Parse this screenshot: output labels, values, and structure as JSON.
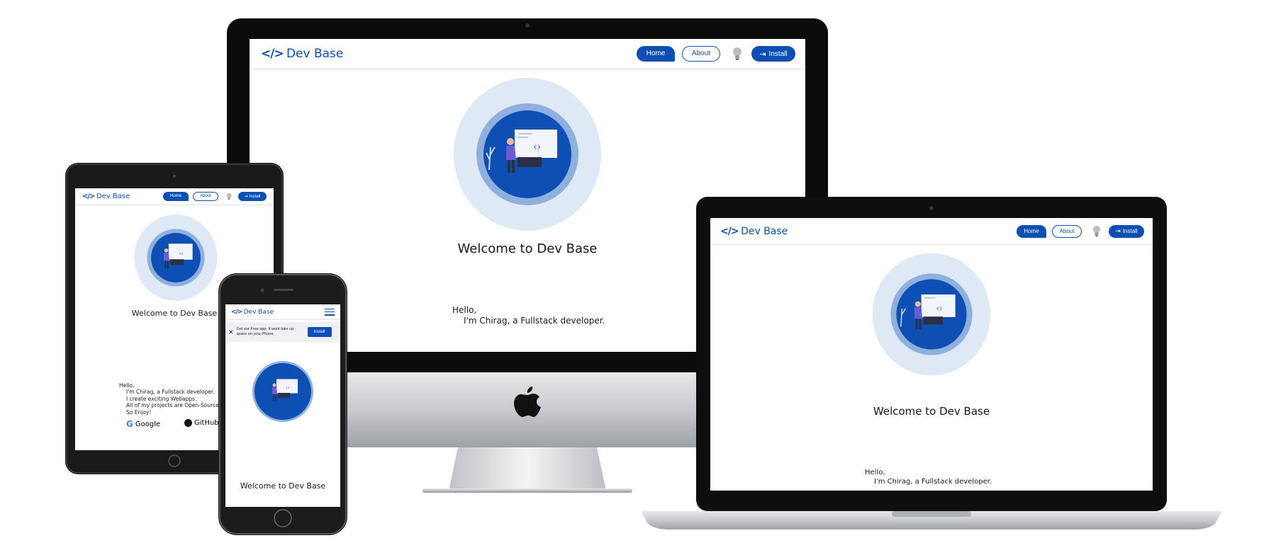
{
  "site": {
    "brand_logo": "</>",
    "brand_name": "Dev Base",
    "nav": {
      "home": "Home",
      "about": "About",
      "install": "Install"
    },
    "welcome": "Welcome to Dev Base",
    "hello": "Hello,",
    "intro": "I'm Chirag, a Fullstack developer.",
    "intro_lines": [
      "I create exciting Webapps.",
      "All of my projects are Open-Source.",
      "So Enjoy!"
    ],
    "links": {
      "google": "Google",
      "github": "GitHub"
    }
  },
  "mobile_banner": {
    "text": "Get our Free app. It wont take up space on your Phone.",
    "install": "Install",
    "close": "✕"
  },
  "colors": {
    "accent": "#0d4fb3",
    "ring_outer": "#dfe9f6",
    "ring_mid": "#8fb0df",
    "ring_inner": "#0d4fb3"
  }
}
